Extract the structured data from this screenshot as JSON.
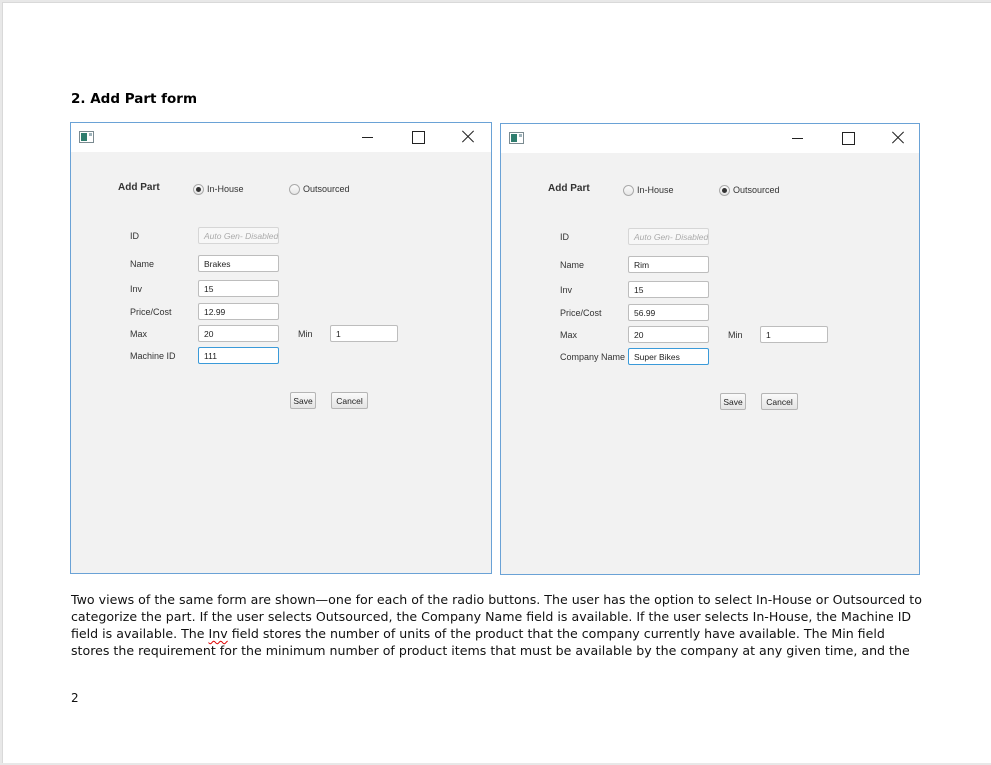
{
  "heading": "2. Add Part form",
  "windows": [
    {
      "form_title": "Add Part",
      "radio_inhouse": "In-House",
      "radio_outsourced": "Outsourced",
      "selected": "In-House",
      "labels": {
        "id": "ID",
        "name": "Name",
        "inv": "Inv",
        "price": "Price/Cost",
        "max": "Max",
        "min": "Min",
        "extra": "Machine ID"
      },
      "values": {
        "id_placeholder": "Auto Gen- Disabled",
        "name": "Brakes",
        "inv": "15",
        "price": "12.99",
        "max": "20",
        "min": "1",
        "extra": "111"
      },
      "buttons": {
        "save": "Save",
        "cancel": "Cancel"
      }
    },
    {
      "form_title": "Add Part",
      "radio_inhouse": "In-House",
      "radio_outsourced": "Outsourced",
      "selected": "Outsourced",
      "labels": {
        "id": "ID",
        "name": "Name",
        "inv": "Inv",
        "price": "Price/Cost",
        "max": "Max",
        "min": "Min",
        "extra": "Company Name"
      },
      "values": {
        "id_placeholder": "Auto Gen- Disabled",
        "name": "Rim",
        "inv": "15",
        "price": "56.99",
        "max": "20",
        "min": "1",
        "extra": "Super Bikes"
      },
      "buttons": {
        "save": "Save",
        "cancel": "Cancel"
      }
    }
  ],
  "paragraph": {
    "line1": "Two views of the same form are shown—one for each of the radio buttons. The user has the option to select In-House or Outsourced to",
    "line2": "categorize the part. If the user selects Outsourced, the Company Name field is available. If the user selects In-House, the Machine ID",
    "line3_pre": "field is available. The ",
    "line3_word": "Inv",
    "line3_post": " field stores the number of units of the product that the company currently have available. The Min field",
    "line4": "stores the requirement for the minimum number of product items that must be available by the company at any given time, and the"
  },
  "page_number": "2"
}
